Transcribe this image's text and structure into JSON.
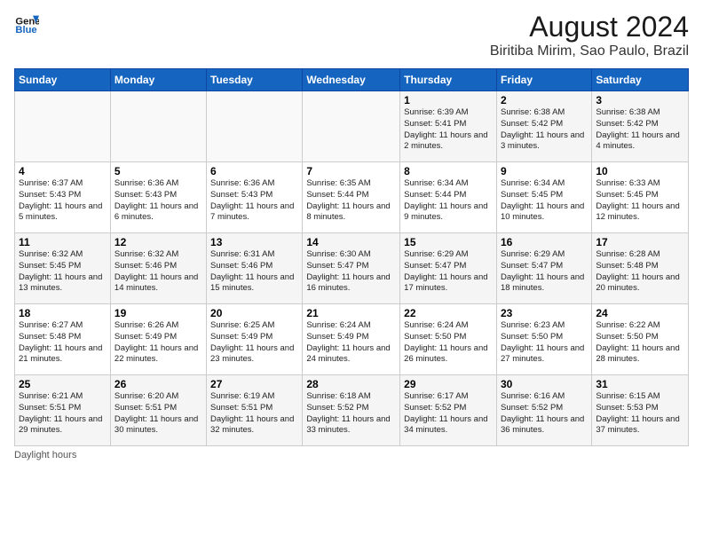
{
  "header": {
    "logo_line1": "General",
    "logo_line2": "Blue",
    "month_year": "August 2024",
    "location": "Biritiba Mirim, Sao Paulo, Brazil"
  },
  "days_of_week": [
    "Sunday",
    "Monday",
    "Tuesday",
    "Wednesday",
    "Thursday",
    "Friday",
    "Saturday"
  ],
  "weeks": [
    [
      {
        "day": "",
        "info": ""
      },
      {
        "day": "",
        "info": ""
      },
      {
        "day": "",
        "info": ""
      },
      {
        "day": "",
        "info": ""
      },
      {
        "day": "1",
        "info": "Sunrise: 6:39 AM\nSunset: 5:41 PM\nDaylight: 11 hours and 2 minutes."
      },
      {
        "day": "2",
        "info": "Sunrise: 6:38 AM\nSunset: 5:42 PM\nDaylight: 11 hours and 3 minutes."
      },
      {
        "day": "3",
        "info": "Sunrise: 6:38 AM\nSunset: 5:42 PM\nDaylight: 11 hours and 4 minutes."
      }
    ],
    [
      {
        "day": "4",
        "info": "Sunrise: 6:37 AM\nSunset: 5:43 PM\nDaylight: 11 hours and 5 minutes."
      },
      {
        "day": "5",
        "info": "Sunrise: 6:36 AM\nSunset: 5:43 PM\nDaylight: 11 hours and 6 minutes."
      },
      {
        "day": "6",
        "info": "Sunrise: 6:36 AM\nSunset: 5:43 PM\nDaylight: 11 hours and 7 minutes."
      },
      {
        "day": "7",
        "info": "Sunrise: 6:35 AM\nSunset: 5:44 PM\nDaylight: 11 hours and 8 minutes."
      },
      {
        "day": "8",
        "info": "Sunrise: 6:34 AM\nSunset: 5:44 PM\nDaylight: 11 hours and 9 minutes."
      },
      {
        "day": "9",
        "info": "Sunrise: 6:34 AM\nSunset: 5:45 PM\nDaylight: 11 hours and 10 minutes."
      },
      {
        "day": "10",
        "info": "Sunrise: 6:33 AM\nSunset: 5:45 PM\nDaylight: 11 hours and 12 minutes."
      }
    ],
    [
      {
        "day": "11",
        "info": "Sunrise: 6:32 AM\nSunset: 5:45 PM\nDaylight: 11 hours and 13 minutes."
      },
      {
        "day": "12",
        "info": "Sunrise: 6:32 AM\nSunset: 5:46 PM\nDaylight: 11 hours and 14 minutes."
      },
      {
        "day": "13",
        "info": "Sunrise: 6:31 AM\nSunset: 5:46 PM\nDaylight: 11 hours and 15 minutes."
      },
      {
        "day": "14",
        "info": "Sunrise: 6:30 AM\nSunset: 5:47 PM\nDaylight: 11 hours and 16 minutes."
      },
      {
        "day": "15",
        "info": "Sunrise: 6:29 AM\nSunset: 5:47 PM\nDaylight: 11 hours and 17 minutes."
      },
      {
        "day": "16",
        "info": "Sunrise: 6:29 AM\nSunset: 5:47 PM\nDaylight: 11 hours and 18 minutes."
      },
      {
        "day": "17",
        "info": "Sunrise: 6:28 AM\nSunset: 5:48 PM\nDaylight: 11 hours and 20 minutes."
      }
    ],
    [
      {
        "day": "18",
        "info": "Sunrise: 6:27 AM\nSunset: 5:48 PM\nDaylight: 11 hours and 21 minutes."
      },
      {
        "day": "19",
        "info": "Sunrise: 6:26 AM\nSunset: 5:49 PM\nDaylight: 11 hours and 22 minutes."
      },
      {
        "day": "20",
        "info": "Sunrise: 6:25 AM\nSunset: 5:49 PM\nDaylight: 11 hours and 23 minutes."
      },
      {
        "day": "21",
        "info": "Sunrise: 6:24 AM\nSunset: 5:49 PM\nDaylight: 11 hours and 24 minutes."
      },
      {
        "day": "22",
        "info": "Sunrise: 6:24 AM\nSunset: 5:50 PM\nDaylight: 11 hours and 26 minutes."
      },
      {
        "day": "23",
        "info": "Sunrise: 6:23 AM\nSunset: 5:50 PM\nDaylight: 11 hours and 27 minutes."
      },
      {
        "day": "24",
        "info": "Sunrise: 6:22 AM\nSunset: 5:50 PM\nDaylight: 11 hours and 28 minutes."
      }
    ],
    [
      {
        "day": "25",
        "info": "Sunrise: 6:21 AM\nSunset: 5:51 PM\nDaylight: 11 hours and 29 minutes."
      },
      {
        "day": "26",
        "info": "Sunrise: 6:20 AM\nSunset: 5:51 PM\nDaylight: 11 hours and 30 minutes."
      },
      {
        "day": "27",
        "info": "Sunrise: 6:19 AM\nSunset: 5:51 PM\nDaylight: 11 hours and 32 minutes."
      },
      {
        "day": "28",
        "info": "Sunrise: 6:18 AM\nSunset: 5:52 PM\nDaylight: 11 hours and 33 minutes."
      },
      {
        "day": "29",
        "info": "Sunrise: 6:17 AM\nSunset: 5:52 PM\nDaylight: 11 hours and 34 minutes."
      },
      {
        "day": "30",
        "info": "Sunrise: 6:16 AM\nSunset: 5:52 PM\nDaylight: 11 hours and 36 minutes."
      },
      {
        "day": "31",
        "info": "Sunrise: 6:15 AM\nSunset: 5:53 PM\nDaylight: 11 hours and 37 minutes."
      }
    ]
  ],
  "footer": {
    "note": "Daylight hours"
  }
}
